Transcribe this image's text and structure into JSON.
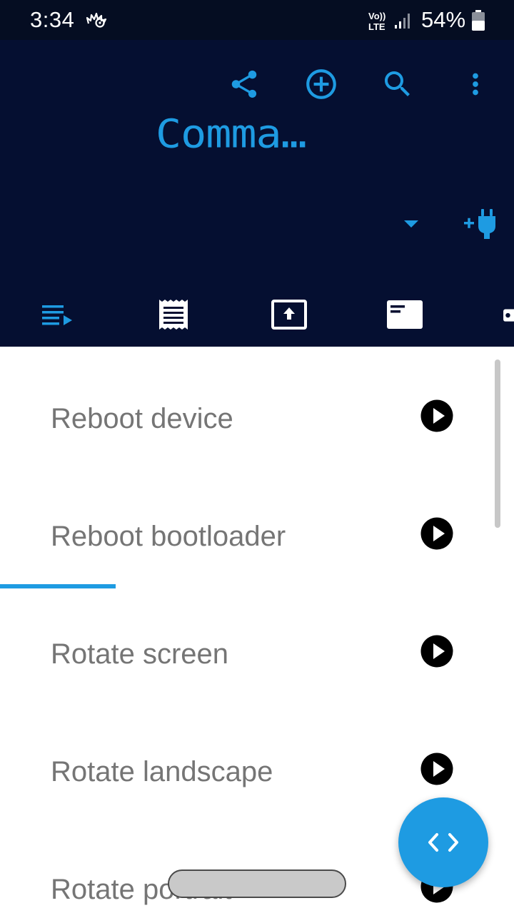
{
  "status_bar": {
    "time": "3:34",
    "app_icon": "hedgehog-icon",
    "network_label_top": "Vo))",
    "network_label_bottom": "LTE",
    "battery_percent": "54%"
  },
  "header": {
    "title": "Comma…",
    "actions": [
      "share-icon",
      "add-circle-icon",
      "search-icon",
      "more-vert-icon"
    ],
    "dropdown_icon": "arrow-drop-down-icon",
    "connect_icon": "add-plug-icon"
  },
  "tabs": [
    {
      "icon": "playlist-play-icon",
      "selected": true
    },
    {
      "icon": "receipt-icon",
      "selected": false
    },
    {
      "icon": "upload-screen-icon",
      "selected": false
    },
    {
      "icon": "card-icon",
      "selected": false
    },
    {
      "icon": "camera-icon",
      "selected": false
    }
  ],
  "commands": [
    {
      "label": "Reboot device"
    },
    {
      "label": "Reboot bootloader"
    },
    {
      "label": "Rotate screen"
    },
    {
      "label": "Rotate landscape"
    },
    {
      "label": "Rotate portrait"
    }
  ],
  "fab": {
    "icon": "code-icon"
  },
  "colors": {
    "status_bar_bg": "#050d22",
    "header_bg": "#050f31",
    "accent": "#1e9be2",
    "item_text": "#757575"
  }
}
